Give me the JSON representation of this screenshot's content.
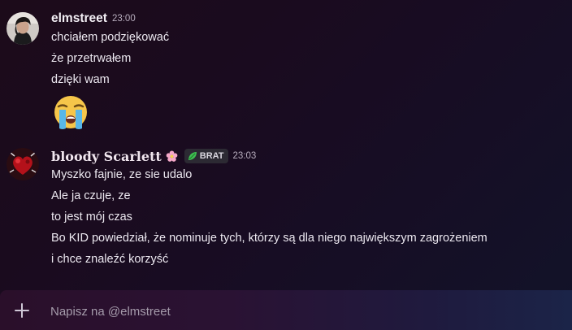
{
  "messages": [
    {
      "author": "elmstreet",
      "time": "23:00",
      "avatar_icon": "user-avatar-photo",
      "lines": [
        "chciałem podziękować",
        "że przetrwałem",
        "dzięki wam"
      ],
      "emoji_icon": "loudly-crying-face-emoji"
    },
    {
      "author": "bloody Scarlett",
      "author_decoration_icon": "cherry-blossom-icon",
      "tag_icon": "leaf-icon",
      "tag": "BRAT",
      "time": "23:03",
      "avatar_icon": "red-heart-avatar",
      "lines": [
        "Myszko fajnie, ze sie udalo",
        "Ale ja czuje, ze",
        "to jest mój czas",
        "Bo KID powiedział, że nominuje tych, którzy są dla niego największym zagrożeniem",
        "i chce znaleźć korzyść"
      ]
    }
  ],
  "composer": {
    "plus_icon": "plus-icon",
    "placeholder": "Napisz na @elmstreet"
  }
}
